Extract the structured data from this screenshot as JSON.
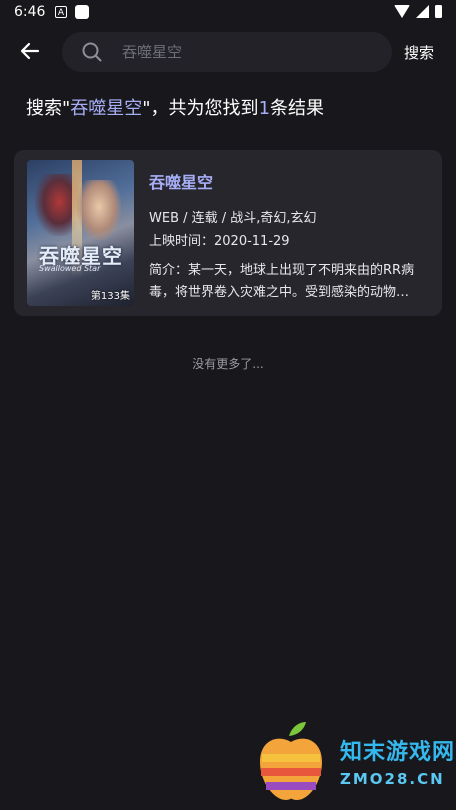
{
  "status_bar": {
    "time": "6:46",
    "notification_letter": "A"
  },
  "search": {
    "query": "吞噬星空",
    "placeholder": "吞噬星空",
    "button_label": "搜索"
  },
  "summary": {
    "prefix": "搜索\"",
    "query": "吞噬星空",
    "middle": "\"，共为您找到",
    "count": "1",
    "suffix": "条结果"
  },
  "results": [
    {
      "title": "吞噬星空",
      "poster_title": "吞噬星空",
      "poster_subtitle": "Swallowed Star",
      "badge": "第133集",
      "genre_line": "WEB / 连载 / 战斗,奇幻,玄幻",
      "date_line": "上映时间：2020-11-29",
      "synopsis": "简介：某一天，地球上出现了不明来由的RR病毒，将世界卷入灾难之中。受到感染的动物变异……"
    }
  ],
  "footer": {
    "no_more": "没有更多了..."
  },
  "watermark": {
    "cn": "知末游戏网",
    "en": "ZMO28.CN"
  },
  "colors": {
    "background": "#18181c",
    "card": "#26262c",
    "accent": "#a7aef6",
    "watermark": "#34b8ee"
  }
}
